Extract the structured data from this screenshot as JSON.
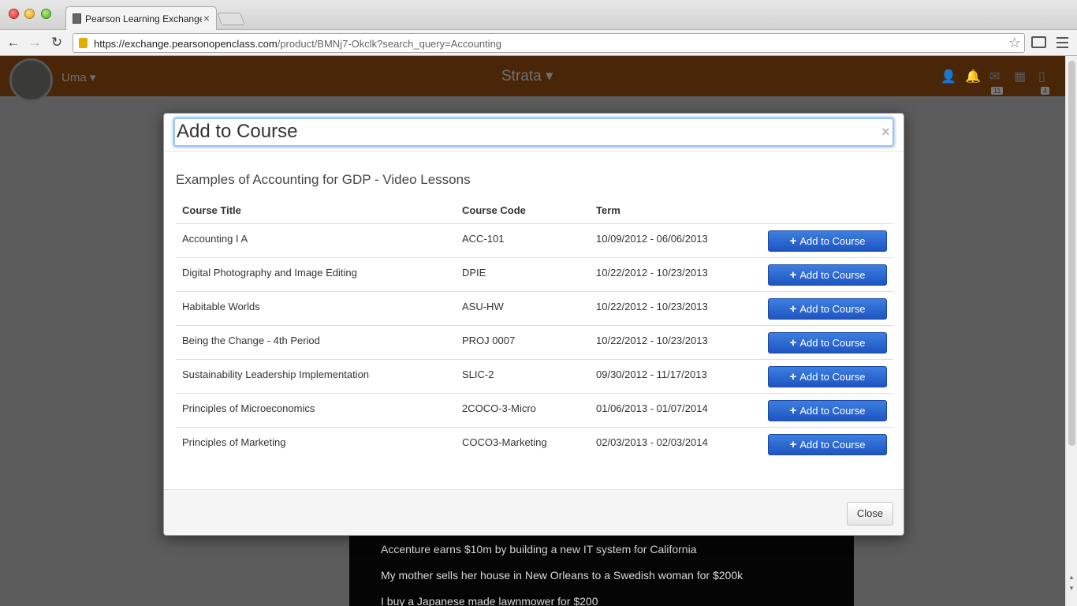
{
  "browser": {
    "tab_title": "Pearson Learning Exchange",
    "url_host": "https://exchange.pearsonopenclass.com",
    "url_path": "/product/BMNj7-Okclk?search_query=Accounting"
  },
  "appbar": {
    "user_name": "Uma",
    "brand": "Strata",
    "mail_count": "11",
    "docs_count": "4"
  },
  "video": {
    "lines": [
      "Accenture earns $10m by building a new IT system for California",
      "My mother sells her house in New Orleans to a Swedish woman for $200k",
      "I buy a Japanese made lawnmower for $200"
    ]
  },
  "modal": {
    "title": "Add to Course",
    "close_x": "×",
    "subtitle": "Examples of Accounting for GDP - Video Lessons",
    "columns": [
      "Course Title",
      "Course Code",
      "Term"
    ],
    "add_button_label": "Add to Course",
    "rows": [
      {
        "title": "Accounting I A",
        "code": "ACC-101",
        "term": "10/09/2012 - 06/06/2013"
      },
      {
        "title": "Digital Photography and Image Editing",
        "code": "DPIE",
        "term": "10/22/2012 - 10/23/2013"
      },
      {
        "title": "Habitable Worlds",
        "code": "ASU-HW",
        "term": "10/22/2012 - 10/23/2013"
      },
      {
        "title": "Being the Change - 4th Period",
        "code": "PROJ 0007",
        "term": "10/22/2012 - 10/23/2013"
      },
      {
        "title": "Sustainability Leadership Implementation",
        "code": "SLIC-2",
        "term": "09/30/2012 - 11/17/2013"
      },
      {
        "title": "Principles of Microeconomics",
        "code": "2COCO-3-Micro",
        "term": "01/06/2013 - 01/07/2014"
      },
      {
        "title": "Principles of Marketing",
        "code": "COCO3-Marketing",
        "term": "02/03/2013 - 02/03/2014"
      }
    ],
    "close_label": "Close"
  }
}
